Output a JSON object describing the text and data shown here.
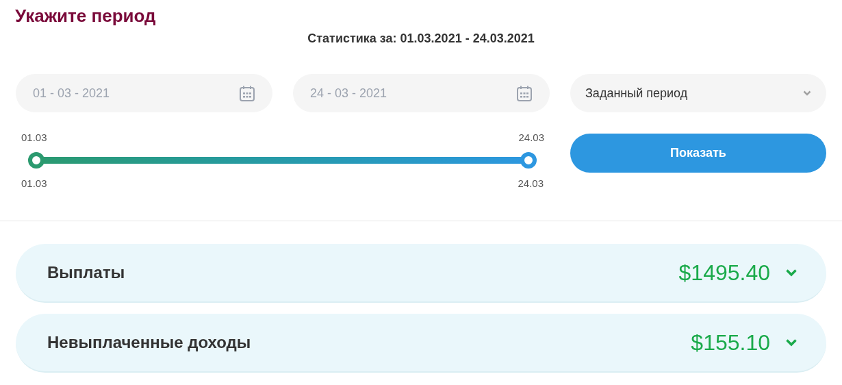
{
  "title": "Укажите период",
  "subtitle": "Статистика за: 01.03.2021 - 24.03.2021",
  "date_from": {
    "value": "01 - 03 - 2021"
  },
  "date_to": {
    "value": "24 - 03 - 2021"
  },
  "period_select": {
    "value": "Заданный период"
  },
  "slider": {
    "min_label": "01.03",
    "max_label": "24.03",
    "low_label": "01.03",
    "high_label": "24.03"
  },
  "show_button": "Показать",
  "summaries": [
    {
      "label": "Выплаты",
      "amount": "$1495.40"
    },
    {
      "label": "Невыплаченные доходы",
      "amount": "$155.10"
    }
  ]
}
